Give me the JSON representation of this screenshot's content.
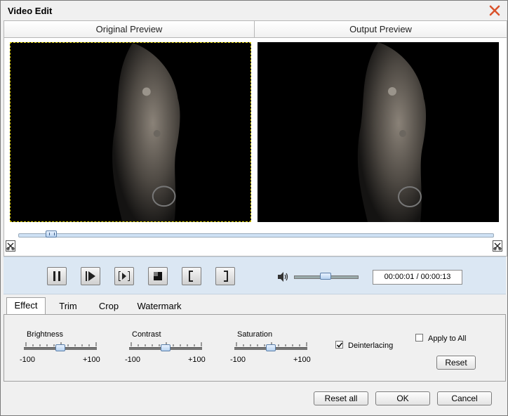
{
  "window": {
    "title": "Video Edit"
  },
  "preview": {
    "original_label": "Original Preview",
    "output_label": "Output Preview"
  },
  "playback": {
    "time": "00:00:01 / 00:00:13",
    "seek_position": 0.07,
    "volume_level": 0.5
  },
  "tabs": [
    {
      "label": "Effect",
      "active": true
    },
    {
      "label": "Trim",
      "active": false
    },
    {
      "label": "Crop",
      "active": false
    },
    {
      "label": "Watermark",
      "active": false
    }
  ],
  "effect": {
    "sliders": [
      {
        "label": "Brightness",
        "min_label": "-100",
        "max_label": "+100",
        "value": 0
      },
      {
        "label": "Contrast",
        "min_label": "-100",
        "max_label": "+100",
        "value": 0
      },
      {
        "label": "Saturation",
        "min_label": "-100",
        "max_label": "+100",
        "value": 0
      }
    ],
    "deinterlacing": {
      "label": "Deinterlacing",
      "checked": true
    },
    "apply_to_all": {
      "label": "Apply to All",
      "checked": false
    },
    "reset_label": "Reset"
  },
  "footer": {
    "reset_all_label": "Reset all",
    "ok_label": "OK",
    "cancel_label": "Cancel"
  },
  "colors": {
    "accent": "#dbe7f3",
    "close": "#d9532c"
  }
}
